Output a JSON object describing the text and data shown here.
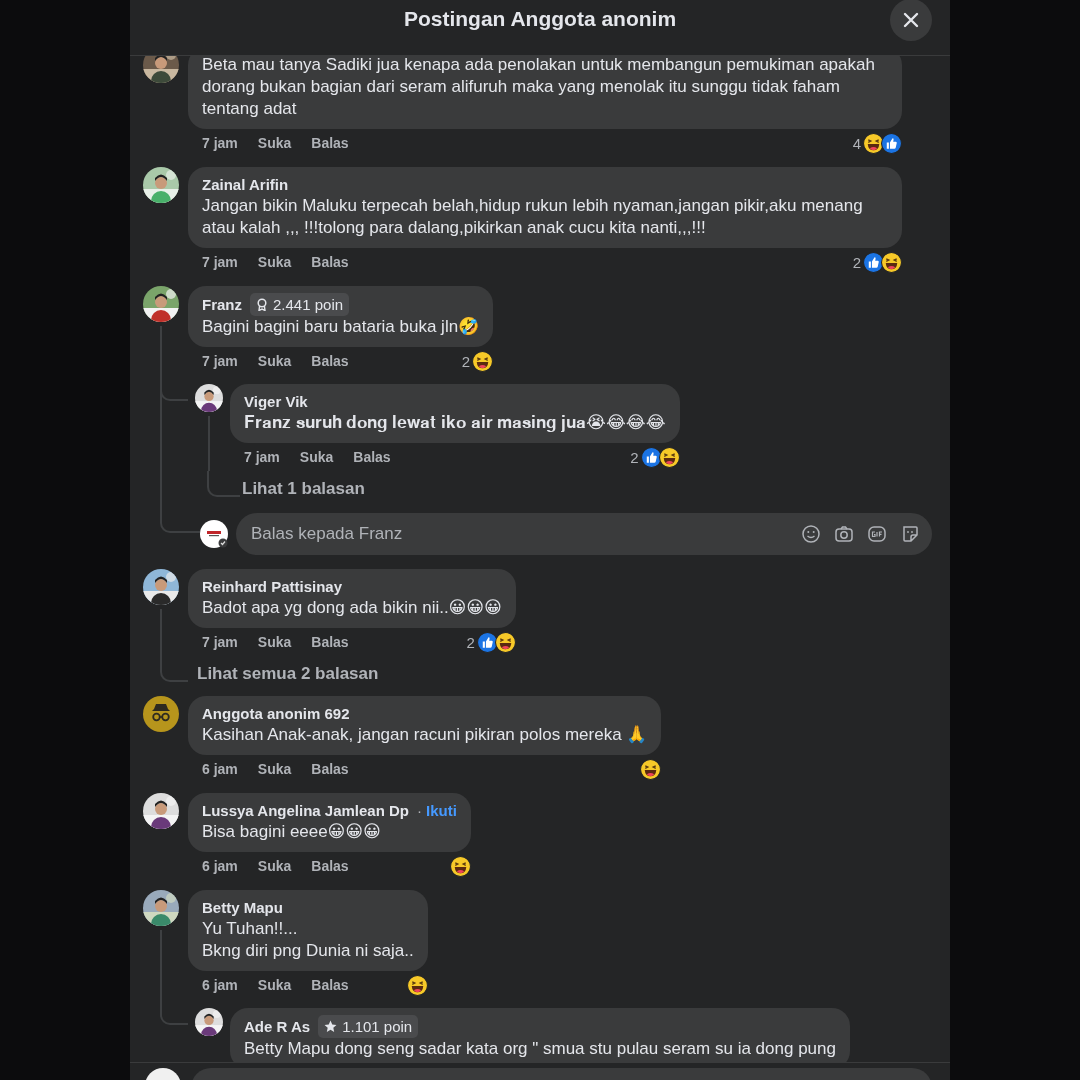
{
  "header": {
    "title": "Postingan Anggota anonim"
  },
  "comments": [
    {
      "kind": "comment",
      "text": "Beta mau tanya Sadiki jua kenapa ada penolakan untuk membangun pemukiman apakah dorang bukan bagian dari seram alifuruh maka yang menolak itu sunggu tidak faham tentang adat",
      "time": "7 jam",
      "like": "Suka",
      "reply": "Balas",
      "reaction_count": "4",
      "reactions": [
        {
          "kind": "haha"
        },
        {
          "kind": "like"
        }
      ]
    },
    {
      "kind": "comment",
      "author": "Zainal Arifin",
      "text": "Jangan bikin Maluku terpecah belah,hidup rukun lebih nyaman,jangan pikir,aku menang atau kalah ,,, !!!tolong para dalang,pikirkan anak cucu kita nanti,,,!!!",
      "time": "7 jam",
      "like": "Suka",
      "reply": "Balas",
      "reaction_count": "2",
      "reactions": [
        {
          "kind": "like"
        },
        {
          "kind": "haha"
        }
      ]
    },
    {
      "kind": "comment",
      "author": "Franz",
      "badge": "2.441 poin",
      "text": "Bagini bagini baru bataria buka jln🤣",
      "time": "7 jam",
      "like": "Suka",
      "reply": "Balas",
      "reaction_count": "2",
      "reactions": [
        {
          "kind": "haha"
        }
      ],
      "children": [
        {
          "kind": "comment",
          "author": "Viger Vik",
          "text": "𝐅𝐫𝐚𝐧𝐳 𝐬𝐮𝐫𝐮𝐡 𝐝𝐨𝐧𝐠 𝐥𝐞𝐰𝐚𝐭 𝐢𝐤𝐨 𝐚𝐢𝐫 𝐦𝐚𝐬𝐢𝐧𝐠 𝐣𝐮𝐚😭😂😂😂",
          "time": "7 jam",
          "like": "Suka",
          "reply": "Balas",
          "reaction_count": "2",
          "reactions": [
            {
              "kind": "like"
            },
            {
              "kind": "haha"
            }
          ],
          "children": [
            {
              "kind": "view_replies",
              "label": "Lihat 1 balasan"
            }
          ]
        },
        {
          "kind": "reply_input",
          "placeholder": "Balas kepada Franz"
        }
      ]
    },
    {
      "kind": "comment",
      "author": "Reinhard Pattisinay",
      "text": "Badot apa yg dong ada bikin nii..😀😀😀",
      "time": "7 jam",
      "like": "Suka",
      "reply": "Balas",
      "reaction_count": "2",
      "reactions": [
        {
          "kind": "like"
        },
        {
          "kind": "haha"
        }
      ],
      "children": [
        {
          "kind": "view_replies",
          "label": "Lihat semua 2 balasan"
        }
      ]
    },
    {
      "kind": "anonymous_comment",
      "author": "Anggota anonim 692",
      "text": "Kasihan Anak-anak, jangan racuni pikiran polos mereka 🙏",
      "time": "6 jam",
      "like": "Suka",
      "reply": "Balas",
      "reactions": [
        {
          "kind": "haha"
        }
      ]
    },
    {
      "kind": "comment",
      "author": "Lussya Angelina Jamlean Dp",
      "separator": "·",
      "follow": "Ikuti",
      "text": "Bisa bagini eeee😀😀😀",
      "time": "6 jam",
      "like": "Suka",
      "reply": "Balas",
      "reactions": [
        {
          "kind": "haha"
        }
      ]
    },
    {
      "kind": "comment",
      "author": "Betty Mapu",
      "text": "Yu Tuhan!!...\nBkng diri png Dunia ni saja..",
      "time": "6 jam",
      "like": "Suka",
      "reply": "Balas",
      "reactions": [
        {
          "kind": "haha"
        }
      ],
      "children": [
        {
          "kind": "comment",
          "author": "Ade R As",
          "badge": "1.101 poin",
          "text": "Betty Mapu dong seng sadar kata org \" smua stu pulau seram su ia dong pung"
        }
      ]
    }
  ]
}
